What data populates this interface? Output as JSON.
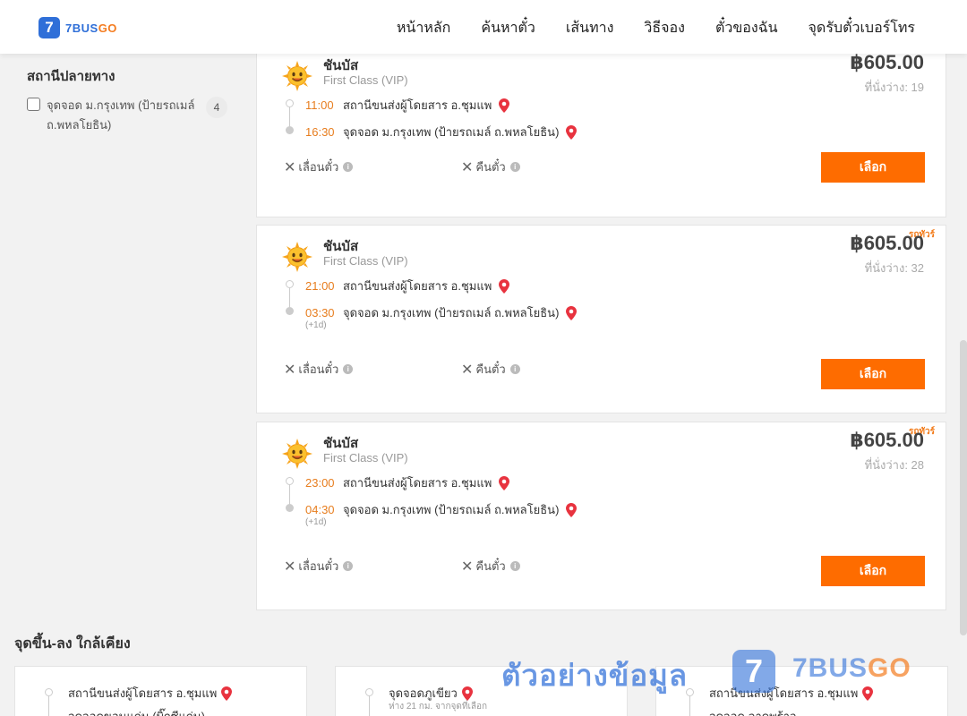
{
  "header": {
    "logo_mark": "7",
    "logo_text_a": "7BUS",
    "logo_text_b": "GO",
    "nav": [
      "หน้าหลัก",
      "ค้นหาตั๋ว",
      "เส้นทาง",
      "วิธีจอง",
      "ตั๋วของฉัน",
      "จุดรับตั๋วเบอร์โทร"
    ]
  },
  "filter": {
    "title": "สถานีปลายทาง",
    "option_label": "จุดจอด ม.กรุงเทพ (ป้ายรถเมล์ ถ.พหลโยธิน)",
    "option_count": "4",
    "checked": false
  },
  "trips": [
    {
      "tag": "",
      "operator": "ชันบัส",
      "class": "First Class (VIP)",
      "price": "฿605.00",
      "seats": "ที่นั่งว่าง: 19",
      "depart_time": "11:00",
      "depart_place": "สถานีขนส่งผู้โดยสาร อ.ชุมแพ",
      "arrive_time": "16:30",
      "arrive_place": "จุดจอด ม.กรุงเทพ (ป้ายรถเมล์ ถ.พหลโยธิน)",
      "next_day": "",
      "change": "เลื่อนตั๋ว",
      "refund": "คืนตั๋ว",
      "select": "เลือก"
    },
    {
      "tag": "รถทัวร์",
      "operator": "ชันบัส",
      "class": "First Class (VIP)",
      "price": "฿605.00",
      "seats": "ที่นั่งว่าง: 32",
      "depart_time": "21:00",
      "depart_place": "สถานีขนส่งผู้โดยสาร อ.ชุมแพ",
      "arrive_time": "03:30",
      "arrive_place": "จุดจอด ม.กรุงเทพ (ป้ายรถเมล์ ถ.พหลโยธิน)",
      "next_day": "(+1d)",
      "change": "เลื่อนตั๋ว",
      "refund": "คืนตั๋ว",
      "select": "เลือก"
    },
    {
      "tag": "รถทัวร์",
      "operator": "ชันบัส",
      "class": "First Class (VIP)",
      "price": "฿605.00",
      "seats": "ที่นั่งว่าง: 28",
      "depart_time": "23:00",
      "depart_place": "สถานีขนส่งผู้โดยสาร อ.ชุมแพ",
      "arrive_time": "04:30",
      "arrive_place": "จุดจอด ม.กรุงเทพ (ป้ายรถเมล์ ถ.พหลโยธิน)",
      "next_day": "(+1d)",
      "change": "เลื่อนตั๋ว",
      "refund": "คืนตั๋ว",
      "select": "เลือก"
    }
  ],
  "nearby": {
    "title": "จุดขึ้น-ลง ใกล้เคียง",
    "cards": [
      {
        "place": "สถานีขนส่งผู้โดยสาร อ.ชุมแพ",
        "sub": "",
        "place2": "จุดจอดขอนแก่น (บิ๊กซีแก่น)"
      },
      {
        "place": "จุดจอดภูเขียว",
        "sub": "ห่าง 21 กม. จากจุดที่เลือก",
        "place2": ""
      },
      {
        "place": "สถานีขนส่งผู้โดยสาร อ.ชุมแพ",
        "sub": "",
        "place2": "จุดจอด ลาดพร้าว"
      }
    ]
  },
  "watermark": {
    "text": "ตัวอย่างข้อมูล",
    "mark": "7",
    "brand_a": "7BUS",
    "brand_b": "GO"
  },
  "colors": {
    "accent": "#fe6c00",
    "time": "#e77d1e",
    "brand_blue": "#2f6fd8",
    "pin": "#e8333f"
  },
  "icons": {
    "operator": "sun-face-icon",
    "pin": "map-pin-icon",
    "close": "x-icon",
    "info": "info-icon"
  }
}
